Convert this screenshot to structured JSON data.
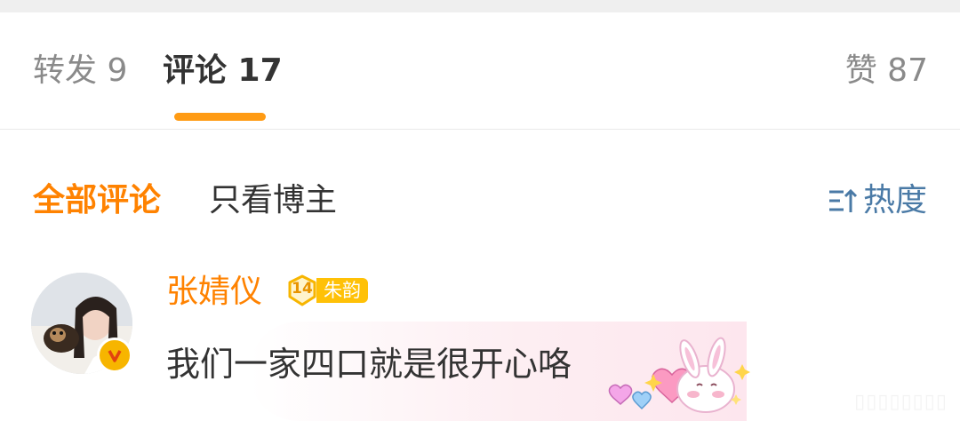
{
  "tabs": {
    "repost": "转发 9",
    "comments": "评论 17",
    "likes": "赞 87"
  },
  "filters": {
    "all": "全部评论",
    "blogger_only": "只看博主",
    "sort": "热度"
  },
  "comment": {
    "username": "张婧仪",
    "fan_level": "14",
    "fan_group": "朱韵",
    "text": "我们一家四口就是很开心咯"
  },
  "colors": {
    "accent": "#ff8200",
    "underline": "#ff9b14",
    "sort_link": "#4a7aa6"
  },
  "icons": {
    "sort": "sort-icon",
    "verified": "verified-v-icon",
    "sticker": "bunny-hearts-sticker"
  }
}
